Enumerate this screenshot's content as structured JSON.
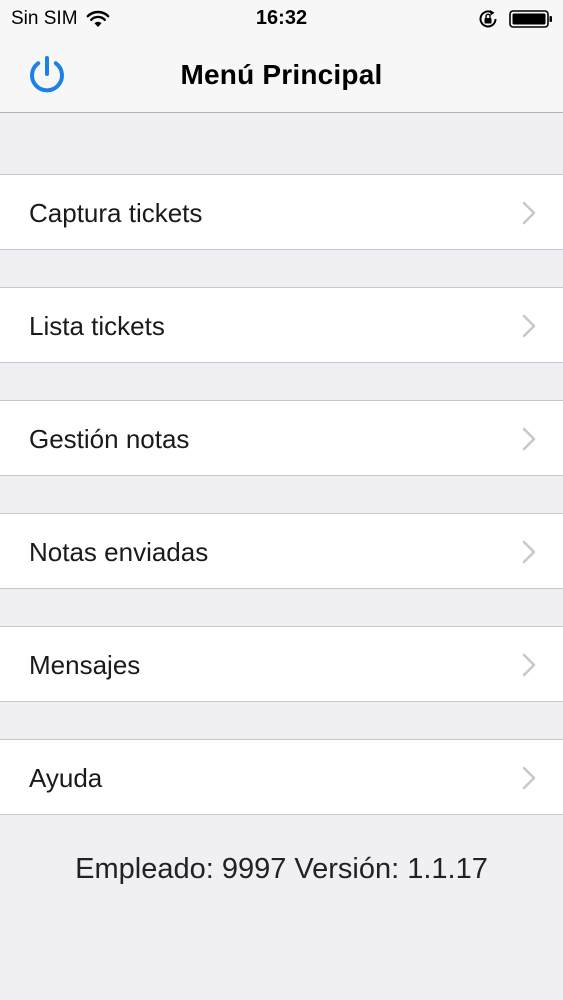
{
  "status_bar": {
    "carrier": "Sin SIM",
    "time": "16:32",
    "wifi_icon": "wifi-icon",
    "rotation_lock_icon": "rotation-lock-icon",
    "battery_icon": "battery-icon"
  },
  "nav": {
    "title": "Menú Principal",
    "power_icon": "power-icon",
    "accent_color": "#1a82e6"
  },
  "menu": {
    "items": [
      {
        "label": "Captura tickets"
      },
      {
        "label": "Lista tickets"
      },
      {
        "label": "Gestión notas"
      },
      {
        "label": "Notas enviadas"
      },
      {
        "label": "Mensajes"
      },
      {
        "label": "Ayuda"
      }
    ]
  },
  "footer": {
    "text": "Empleado: 9997 Versión: 1.1.17"
  }
}
